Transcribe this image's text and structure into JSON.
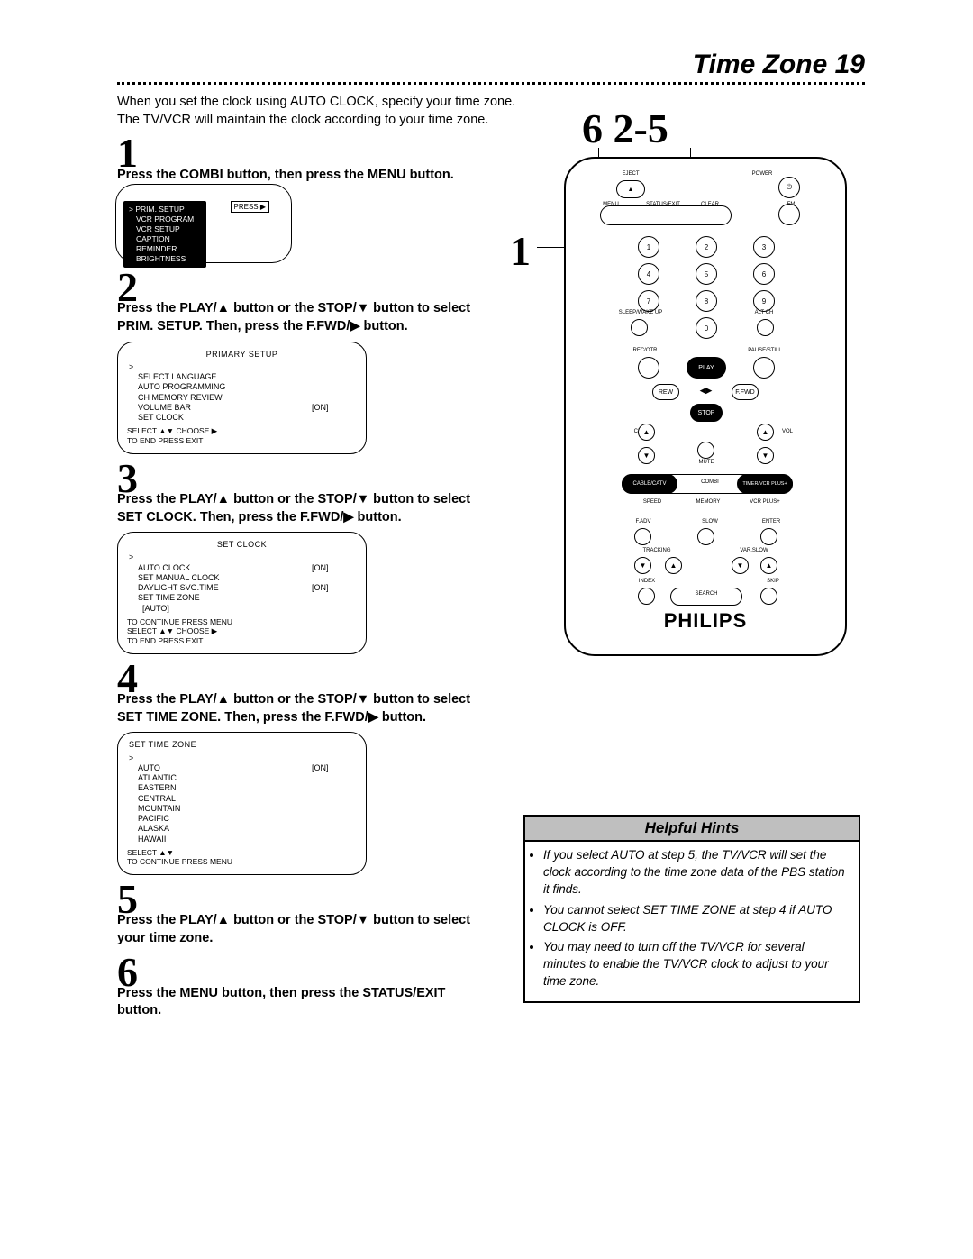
{
  "header": {
    "title": "Time Zone",
    "page_number": "19"
  },
  "intro_line1": "When you set the clock using AUTO CLOCK, specify your time zone.",
  "intro_line2": "The TV/VCR will maintain the clock according to your time zone.",
  "callouts": {
    "top": "6  2-5",
    "left": "1"
  },
  "steps": {
    "s1": {
      "num": "1",
      "text": "Press the COMBI button, then press the MENU button."
    },
    "s2": {
      "num": "2",
      "text_a": "Press the PLAY/▲ button or the STOP/▼ button to select",
      "text_b": "PRIM. SETUP.  Then, press the F.FWD/▶ button."
    },
    "s3": {
      "num": "3",
      "text_a": "Press the PLAY/▲ button or the STOP/▼ button to select",
      "text_b": "SET CLOCK. Then, press the F.FWD/▶ button."
    },
    "s4": {
      "num": "4",
      "text_a": "Press the PLAY/▲ button or the STOP/▼ button to select",
      "text_b": "SET TIME ZONE. Then, press the F.FWD/▶ button."
    },
    "s5": {
      "num": "5",
      "text_a": "Press the PLAY/▲ button or the STOP/▼ button to select",
      "text_b": "your time zone."
    },
    "s6": {
      "num": "6",
      "text_a": "Press the MENU button, then press the STATUS/EXIT",
      "text_b": "button."
    }
  },
  "osd1": {
    "press_label": "PRESS ▶",
    "items": [
      "PRIM. SETUP",
      "VCR PROGRAM",
      "VCR SETUP",
      "CAPTION",
      "REMINDER",
      "BRIGHTNESS"
    ]
  },
  "osd2": {
    "title": "PRIMARY SETUP",
    "items": [
      {
        "k": "SELECT LANGUAGE",
        "v": "",
        "sel": true
      },
      {
        "k": "AUTO PROGRAMMING",
        "v": ""
      },
      {
        "k": "CH MEMORY REVIEW",
        "v": ""
      },
      {
        "k": "VOLUME BAR",
        "v": "[ON]"
      },
      {
        "k": "SET CLOCK",
        "v": ""
      }
    ],
    "foot1": "SELECT ▲▼ CHOOSE ▶",
    "foot2": "TO  END  PRESS  EXIT"
  },
  "osd3": {
    "title": "SET CLOCK",
    "items": [
      {
        "k": "AUTO CLOCK",
        "v": "[ON]",
        "sel": true
      },
      {
        "k": "SET MANUAL CLOCK",
        "v": ""
      },
      {
        "k": "DAYLIGHT SVG.TIME",
        "v": "[ON]"
      },
      {
        "k": "SET TIME ZONE",
        "v": ""
      },
      {
        "k": "  [AUTO]",
        "v": ""
      }
    ],
    "foot0": "TO CONTINUE PRESS MENU",
    "foot1": "SELECT ▲▼ CHOOSE ▶",
    "foot2": "TO  END  PRESS  EXIT"
  },
  "osd4": {
    "title": "SET TIME ZONE",
    "items": [
      {
        "k": "AUTO",
        "v": "[ON]",
        "sel": true
      },
      {
        "k": "ATLANTIC",
        "v": ""
      },
      {
        "k": "EASTERN",
        "v": ""
      },
      {
        "k": "CENTRAL",
        "v": ""
      },
      {
        "k": "MOUNTAIN",
        "v": ""
      },
      {
        "k": "PACIFIC",
        "v": ""
      },
      {
        "k": "ALASKA",
        "v": ""
      },
      {
        "k": "HAWAII",
        "v": ""
      }
    ],
    "foot1": "SELECT ▲▼",
    "foot2": "TO CONTINUE PRESS MENU"
  },
  "remote": {
    "brand": "PHILIPS",
    "labels": {
      "eject": "EJECT",
      "power": "POWER",
      "menu": "MENU",
      "status": "STATUS/EXIT",
      "clear": "CLEAR",
      "fm": "FM",
      "sleep": "SLEEP/WAKE UP",
      "altch": "ALT CH",
      "rec": "REC/OTR",
      "play": "PLAY",
      "pause": "PAUSE/STILL",
      "rew": "REW",
      "ffwd": "F.FWD",
      "stop": "STOP",
      "ch": "CH",
      "vol": "VOL",
      "mute": "MUTE",
      "cable": "CABLE/CATV",
      "combi": "COMBI",
      "timer": "TIMER/VCR PLUS+",
      "speed": "SPEED",
      "memory": "MEMORY",
      "vcrplus": "VCR PLUS+",
      "fadv": "F.ADV",
      "slow": "SLOW",
      "enter": "ENTER",
      "tracking": "TRACKING",
      "varslow": "VAR.SLOW",
      "index": "INDEX",
      "search": "SEARCH",
      "skip": "SKIP"
    },
    "digits": [
      "1",
      "2",
      "3",
      "4",
      "5",
      "6",
      "7",
      "8",
      "9",
      "0"
    ]
  },
  "hints": {
    "title": "Helpful Hints",
    "items": [
      "If you select AUTO at step 5, the TV/VCR will set the clock according to the time zone data of the PBS station it finds.",
      "You cannot select SET TIME ZONE at step 4 if AUTO CLOCK is OFF.",
      "You may need to turn off the TV/VCR for several minutes to enable the TV/VCR clock to adjust to your time zone."
    ]
  }
}
